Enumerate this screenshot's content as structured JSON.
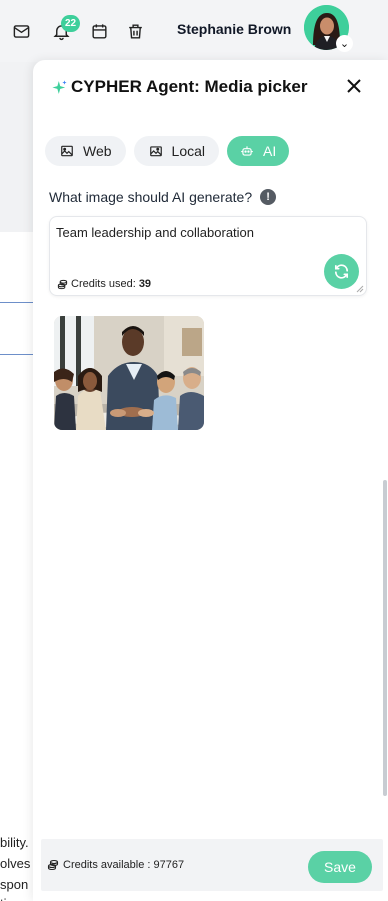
{
  "topbar": {
    "notification_count": "22",
    "user_name": "Stephanie Brown",
    "icons": [
      "mail-icon",
      "bell-icon",
      "calendar-icon",
      "trash-icon"
    ]
  },
  "background": {
    "text_fragments": [
      "bility.",
      "olves",
      "spon",
      "tic"
    ]
  },
  "panel": {
    "title": "CYPHER Agent: Media picker",
    "tabs": [
      {
        "label": "Web",
        "icon": "image-icon",
        "active": false
      },
      {
        "label": "Local",
        "icon": "folder-image-icon",
        "active": false
      },
      {
        "label": "AI",
        "icon": "robot-icon",
        "active": true
      }
    ],
    "question": "What image should AI generate?",
    "prompt_value": "Team leadership and collaboration",
    "credits_used_label": "Credits used:",
    "credits_used_value": "39",
    "footer": {
      "credits_available": "Credits available : 97767",
      "save_label": "Save"
    }
  },
  "colors": {
    "accent": "#5ad1a5",
    "badge": "#3ecf9b"
  }
}
